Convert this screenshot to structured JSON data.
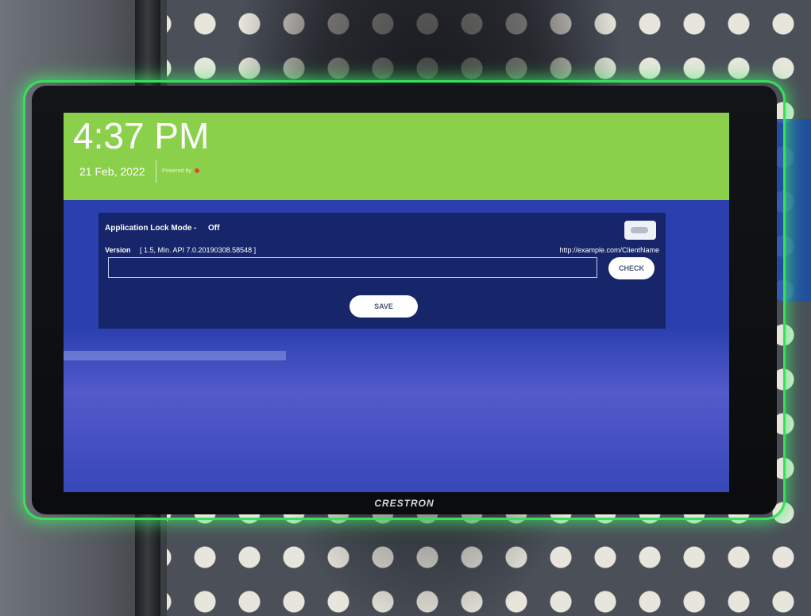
{
  "header": {
    "time": "4:37 PM",
    "date": "21 Feb, 2022",
    "powered_by": "Powered by"
  },
  "settings": {
    "lock_mode_label": "Application Lock Mode",
    "lock_mode_separator": "-",
    "lock_mode_value": "Off",
    "version_label": "Version",
    "version_value": "[ 1.5, Min. API 7.0.20190308.58548 ]",
    "url_hint": "http://example.com/ClientName",
    "url_value": "",
    "check_label": "CHECK",
    "save_label": "SAVE"
  },
  "device": {
    "brand": "CRESTRON"
  },
  "colors": {
    "header_green": "#8bd04a",
    "screen_blue": "#2b3fae",
    "panel_navy": "#17256a",
    "led_green": "#36e05a"
  }
}
